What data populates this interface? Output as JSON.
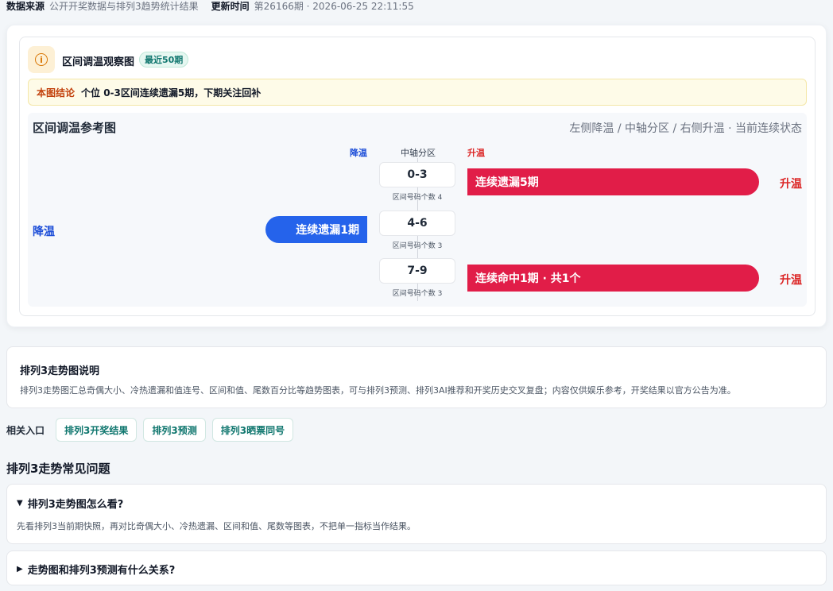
{
  "meta": {
    "source_label": "数据来源",
    "source_value": "公开开奖数据与排列3趋势统计结果",
    "updated_label": "更新时间",
    "updated_value": "第26166期 · 2026-06-25 22:11:55"
  },
  "card": {
    "title": "区间调温观察图",
    "badge": "最近50期",
    "icon": "info-icon",
    "conclusion_tag": "本图结论",
    "conclusion_text": "个位 0-3区间连续遗漏5期，下期关注回补"
  },
  "chart_data": {
    "type": "diverging-bar",
    "title": "区间调温参考图",
    "subtitle": "左侧降温 / 中轴分区 / 右侧升温 · 当前连续状态",
    "headers": {
      "down": "降温",
      "mid": "中轴分区",
      "up": "升温"
    },
    "rows": [
      {
        "zone": "0-3",
        "count_text": "区间号码个数 4",
        "direction": "up",
        "bar_label": "连续遗漏5期",
        "side_label": "升温"
      },
      {
        "zone": "4-6",
        "count_text": "区间号码个数 3",
        "direction": "down",
        "bar_label": "连续遗漏1期",
        "side_label": "降温"
      },
      {
        "zone": "7-9",
        "count_text": "区间号码个数 3",
        "direction": "up",
        "bar_label": "连续命中1期 · 共1个",
        "side_label": "升温"
      }
    ],
    "colors": {
      "up": "#e11d48",
      "down": "#2563eb"
    }
  },
  "description": {
    "title": "排列3走势图说明",
    "text": "排列3走势图汇总奇偶大小、冷热遗漏和值连号、区间和值、尾数百分比等趋势图表，可与排列3预测、排列3AI推荐和开奖历史交叉复盘；内容仅供娱乐参考，开奖结果以官方公告为准。"
  },
  "links": {
    "label": "相关入口",
    "items": [
      "排列3开奖结果",
      "排列3预测",
      "排列3晒票同号"
    ]
  },
  "faq": {
    "heading": "排列3走势常见问题",
    "items": [
      {
        "question": "排列3走势图怎么看?",
        "answer": "先看排列3当前期快照，再对比奇偶大小、冷热遗漏、区间和值、尾数等图表，不把单一指标当作结果。",
        "open": true
      },
      {
        "question": "走势图和排列3预测有什么关系?",
        "open": false
      }
    ]
  }
}
